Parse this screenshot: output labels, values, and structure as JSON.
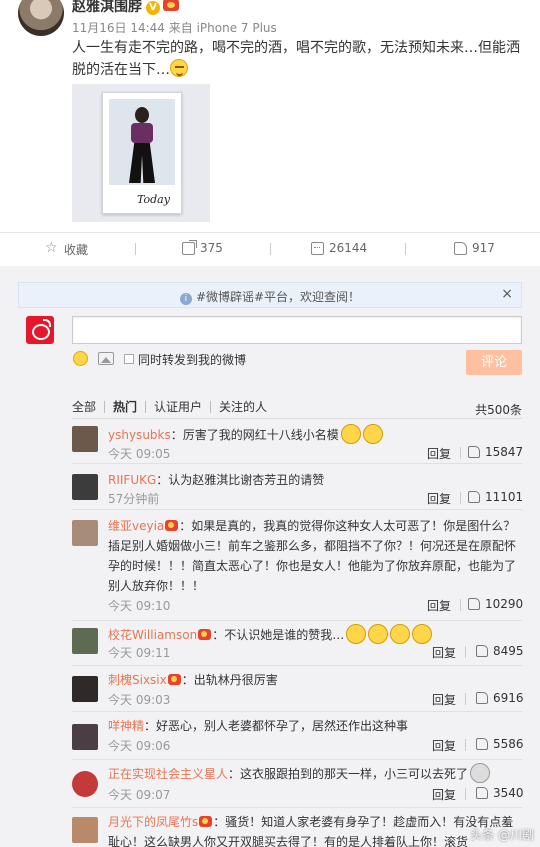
{
  "post": {
    "username": "赵雅淇围脖",
    "verified_mark": "V",
    "meta": "11月16日 14:44 来自 iPhone 7 Plus",
    "text": "人一生有走不完的路，喝不完的酒，唱不完的歌，无法预知未来…但能洒脱的活在当下…",
    "image_caption": "Today",
    "actions": {
      "favorite_label": "收藏",
      "repost_count": "375",
      "comment_count": "26144",
      "like_count": "917"
    }
  },
  "comment_box": {
    "notice": "#微博辟谣#平台，欢迎查阅！",
    "notice_close": "×",
    "input_value": "",
    "also_repost_label": "同时转发到我的微博",
    "submit_label": "评论"
  },
  "filters": {
    "items": [
      "全部",
      "热门",
      "认证用户",
      "关注的人"
    ],
    "active": "热门",
    "total": "共500条"
  },
  "comments": [
    {
      "user": "yshysubks",
      "text": "：厉害了我的网红十八线小名模",
      "time": "今天 09:05",
      "reply": "回复",
      "likes": "15847",
      "avatar_color": "#6b5a4b"
    },
    {
      "user": "RIIFUKG",
      "text": "：认为赵雅淇比谢杏芳丑的请赞",
      "time": "57分钟前",
      "reply": "回复",
      "likes": "11101",
      "avatar_color": "#3c3c3c"
    },
    {
      "user": "维亚veyia",
      "text": "：如果是真的，我真的觉得你这种女人太可恶了！你是图什么？插足别人婚姻做小三！前车之鉴那么多，都阻挡不了你？！何况还是在原配怀孕的时候！！！简直太恶心了！你也是女人！他能为了你放弃原配，也能为了别人放弃你！！！",
      "time": "今天 09:10",
      "reply": "回复",
      "likes": "10290",
      "avatar_color": "#a88c7a"
    },
    {
      "user": "校花Williamson",
      "text": "：不认识她是谁的赞我…",
      "time": "今天 09:11",
      "reply": "回复",
      "likes": "8495",
      "avatar_color": "#5e6b52"
    },
    {
      "user": "刺槐Sixsix",
      "text": "：出轨林丹很厉害",
      "time": "今天 09:03",
      "reply": "回复",
      "likes": "6916",
      "avatar_color": "#2f2a28"
    },
    {
      "user": "咩神精",
      "text": "：好恶心，别人老婆都怀孕了，居然还作出这种事",
      "time": "今天 09:06",
      "reply": "回复",
      "likes": "5586",
      "avatar_color": "#4a3d44"
    },
    {
      "user": "正在实现社会主义星人",
      "text": "：这衣服跟拍到的那天一样，小三可以去死了",
      "time": "今天 09:07",
      "reply": "回复",
      "likes": "3540",
      "avatar_color": "#c23a3a"
    },
    {
      "user": "月光下的凤尾竹s",
      "text": "：骚货！知道人家老婆有身孕了！趁虚而入！有没有点羞耻心！这么缺男人你又开双腿买去得了！有的是人排着队上你！滚货",
      "time": "",
      "reply": "",
      "likes": "",
      "avatar_color": "#b98a6a"
    }
  ],
  "watermark": "头条 @川剧"
}
